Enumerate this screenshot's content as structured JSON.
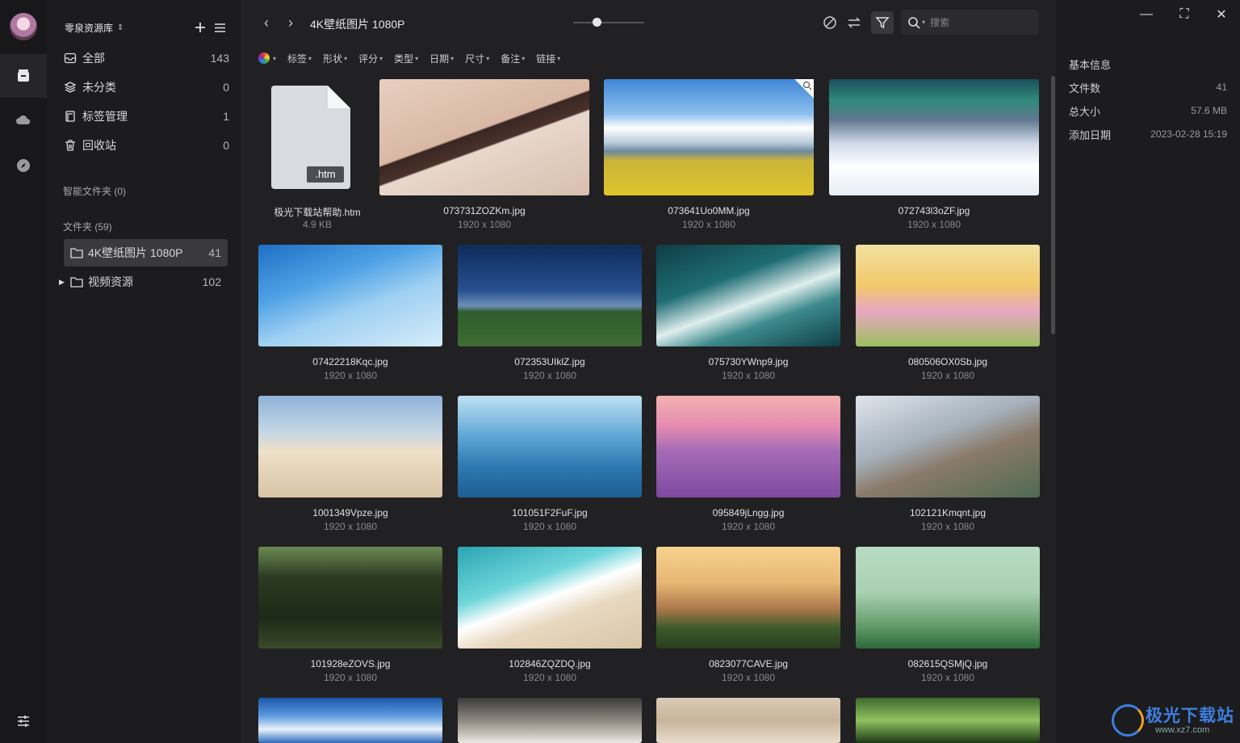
{
  "library": {
    "name": "零泉资源库"
  },
  "nav": [
    {
      "label": "全部",
      "count": "143",
      "icon": "inbox-icon"
    },
    {
      "label": "未分类",
      "count": "0",
      "icon": "layers-icon"
    },
    {
      "label": "标签管理",
      "count": "1",
      "icon": "tag-icon"
    },
    {
      "label": "回收站",
      "count": "0",
      "icon": "trash-icon"
    }
  ],
  "smart_folders": "智能文件夹 (0)",
  "folders_title": "文件夹 (59)",
  "folders": [
    {
      "label": "4K壁纸图片 1080P",
      "count": "41"
    },
    {
      "label": "视频资源",
      "count": "102"
    }
  ],
  "toolbar": {
    "title": "4K壁纸图片 1080P",
    "search_placeholder": "搜索"
  },
  "filters": [
    "标签",
    "形状",
    "评分",
    "类型",
    "日期",
    "尺寸",
    "备注",
    "链接"
  ],
  "files": [
    {
      "name": "极光下载站帮助.htm",
      "meta": "4.9 KB",
      "ext": ".htm"
    },
    {
      "name": "073731ZOZKm.jpg",
      "meta": "1920 x 1080"
    },
    {
      "name": "073641Uo0MM.jpg",
      "meta": "1920 x 1080"
    },
    {
      "name": "072743l3oZF.jpg",
      "meta": "1920 x 1080"
    },
    {
      "name": "07422218Kqc.jpg",
      "meta": "1920 x 1080"
    },
    {
      "name": "072353UIklZ.jpg",
      "meta": "1920 x 1080"
    },
    {
      "name": "075730YWnp9.jpg",
      "meta": "1920 x 1080"
    },
    {
      "name": "080506OX0Sb.jpg",
      "meta": "1920 x 1080"
    },
    {
      "name": "1001349Vpze.jpg",
      "meta": "1920 x 1080"
    },
    {
      "name": "101051F2FuF.jpg",
      "meta": "1920 x 1080"
    },
    {
      "name": "095849jLngg.jpg",
      "meta": "1920 x 1080"
    },
    {
      "name": "102121Kmqnt.jpg",
      "meta": "1920 x 1080"
    },
    {
      "name": "101928eZOVS.jpg",
      "meta": "1920 x 1080"
    },
    {
      "name": "102846ZQZDQ.jpg",
      "meta": "1920 x 1080"
    },
    {
      "name": "0823077CAVE.jpg",
      "meta": "1920 x 1080"
    },
    {
      "name": "082615QSMjQ.jpg",
      "meta": "1920 x 1080"
    },
    {
      "name": "",
      "meta": ""
    },
    {
      "name": "",
      "meta": ""
    },
    {
      "name": "",
      "meta": ""
    },
    {
      "name": "",
      "meta": ""
    }
  ],
  "info": {
    "title": "基本信息",
    "rows": [
      {
        "key": "文件数",
        "value": "41"
      },
      {
        "key": "总大小",
        "value": "57.6 MB"
      },
      {
        "key": "添加日期",
        "value": "2023-02-28 15:19"
      }
    ]
  },
  "watermark": {
    "brand": "极光下载站",
    "url": "www.xz7.com"
  },
  "colors": {
    "accent": "#3e7fe0",
    "background": "#212123",
    "sidebar": "#1c1c1e"
  }
}
